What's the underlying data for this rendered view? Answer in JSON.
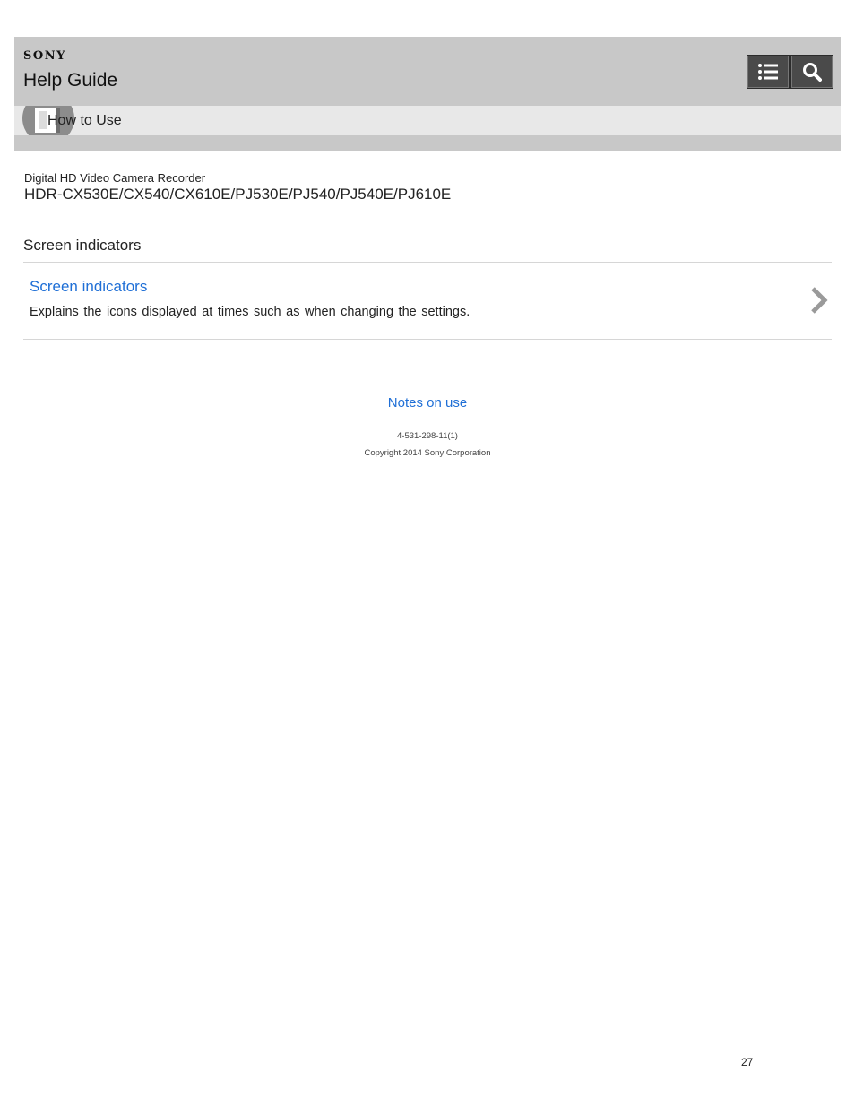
{
  "header": {
    "brand": "SONY",
    "title": "Help Guide",
    "buttons": {
      "contents_icon": "list-icon",
      "search_icon": "search-icon"
    },
    "category": {
      "icon": "book-icon",
      "label": "How to Use"
    }
  },
  "product": {
    "type": "Digital HD Video Camera Recorder",
    "models": "HDR-CX530E/CX540/CX610E/PJ530E/PJ540/PJ540E/PJ610E"
  },
  "main": {
    "section_heading": "Screen indicators",
    "topics": [
      {
        "title": "Screen indicators",
        "description": "Explains the icons displayed at times such as when changing the settings.",
        "icon": "chevron-right-icon"
      }
    ]
  },
  "footer": {
    "notes_link": "Notes on use",
    "doc_number": "4-531-298-11(1)",
    "copyright": "Copyright 2014 Sony Corporation"
  },
  "page_number": "27",
  "colors": {
    "header_bg": "#c8c8c8",
    "category_bg": "#e8e8e8",
    "link": "#1f6fd6",
    "button_bg": "#4a4a4a"
  }
}
